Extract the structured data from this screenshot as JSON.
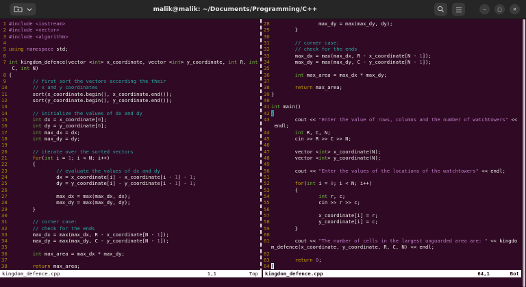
{
  "titlebar": {
    "title": "malik@malik: ~/Documents/Programming/C++",
    "minimize_glyph": "–",
    "maximize_glyph": "▢",
    "close_glyph": "✕"
  },
  "colors": {
    "terminal_bg": "#300A24",
    "header_bg": "#262626",
    "foreground": "#EFEFEC",
    "line_number": "#A98F00",
    "comment": "#2AA7A7",
    "string_preproc": "#BD7BC4",
    "keyword": "#C4A000",
    "type": "#6CB33E",
    "number": "#AD7FA8",
    "matchparen_bg": "#2BA6A6",
    "statusbar_bg": "#FFFFFF"
  },
  "icons": [
    "new-tab-folder-icon",
    "chevron-down-icon",
    "search-icon",
    "menu-icon",
    "minimize-icon",
    "maximize-icon",
    "close-icon"
  ],
  "panes": [
    {
      "side": "left",
      "status": {
        "file": "kingdom_defence.cpp",
        "ruler": "1,1",
        "pos": "Top"
      },
      "rows": [
        {
          "n": "1",
          "t": [
            [
              "s",
              "#include"
            ],
            [
              "w",
              " "
            ],
            [
              "s",
              "<iostream>"
            ]
          ]
        },
        {
          "n": "2",
          "t": [
            [
              "s",
              "#include"
            ],
            [
              "w",
              " "
            ],
            [
              "s",
              "<vector>"
            ]
          ]
        },
        {
          "n": "3",
          "t": [
            [
              "s",
              "#include"
            ],
            [
              "w",
              " "
            ],
            [
              "s",
              "<algorithm>"
            ]
          ]
        },
        {
          "n": "4",
          "t": []
        },
        {
          "n": "5",
          "t": [
            [
              "k",
              "using"
            ],
            [
              "w",
              " "
            ],
            [
              "s",
              "namespace"
            ],
            [
              "w",
              " std;"
            ]
          ]
        },
        {
          "n": "6",
          "t": []
        },
        {
          "n": "7",
          "t": [
            [
              "t",
              "int"
            ],
            [
              "w",
              " kingdom_defence(vector <"
            ],
            [
              "t",
              "int"
            ],
            [
              "w",
              "> x_coordinate, vector <"
            ],
            [
              "t",
              "int"
            ],
            [
              "w",
              "> y_coordinate, "
            ],
            [
              "t",
              "int"
            ],
            [
              "w",
              " R, "
            ],
            [
              "t",
              "int"
            ]
          ]
        },
        {
          "n": "",
          "t": [
            [
              "w",
              " C, "
            ],
            [
              "t",
              "int"
            ],
            [
              "w",
              " N)"
            ]
          ]
        },
        {
          "n": "8",
          "t": [
            [
              "w",
              "{"
            ]
          ]
        },
        {
          "n": "9",
          "t": [
            [
              "c",
              "        // first sort the vectors according the their"
            ]
          ]
        },
        {
          "n": "10",
          "t": [
            [
              "c",
              "        // x and y coordinates"
            ]
          ]
        },
        {
          "n": "11",
          "t": [
            [
              "w",
              "        sort(x_coordinate.begin(), x_coordinate.end());"
            ]
          ]
        },
        {
          "n": "12",
          "t": [
            [
              "w",
              "        sort(y_coordinate.begin(), y_coordinate.end());"
            ]
          ]
        },
        {
          "n": "13",
          "t": []
        },
        {
          "n": "14",
          "t": [
            [
              "c",
              "        // initialize the values of dx and dy"
            ]
          ]
        },
        {
          "n": "15",
          "t": [
            [
              "w",
              "        "
            ],
            [
              "t",
              "int"
            ],
            [
              "w",
              " dx = x_coordinate["
            ],
            [
              "m",
              "0"
            ],
            [
              "w",
              "];"
            ]
          ]
        },
        {
          "n": "16",
          "t": [
            [
              "w",
              "        "
            ],
            [
              "t",
              "int"
            ],
            [
              "w",
              " dy = y_coordinate["
            ],
            [
              "m",
              "0"
            ],
            [
              "w",
              "];"
            ]
          ]
        },
        {
          "n": "17",
          "t": [
            [
              "w",
              "        "
            ],
            [
              "t",
              "int"
            ],
            [
              "w",
              " max_dx = dx;"
            ]
          ]
        },
        {
          "n": "18",
          "t": [
            [
              "w",
              "        "
            ],
            [
              "t",
              "int"
            ],
            [
              "w",
              " max_dy = dy;"
            ]
          ]
        },
        {
          "n": "19",
          "t": []
        },
        {
          "n": "20",
          "t": [
            [
              "c",
              "        // iterate over the sorted vectors"
            ]
          ]
        },
        {
          "n": "21",
          "t": [
            [
              "w",
              "        "
            ],
            [
              "k",
              "for"
            ],
            [
              "w",
              "("
            ],
            [
              "t",
              "int"
            ],
            [
              "w",
              " i = "
            ],
            [
              "m",
              "1"
            ],
            [
              "w",
              "; i < N; i++)"
            ]
          ]
        },
        {
          "n": "22",
          "t": [
            [
              "w",
              "        {"
            ]
          ]
        },
        {
          "n": "23",
          "t": [
            [
              "c",
              "                // evaluate the values of dx and dy"
            ]
          ]
        },
        {
          "n": "24",
          "t": [
            [
              "w",
              "                dx = x_coordinate[i] - x_coordinate[i - "
            ],
            [
              "m",
              "1"
            ],
            [
              "w",
              "] - "
            ],
            [
              "m",
              "1"
            ],
            [
              "w",
              ";"
            ]
          ]
        },
        {
          "n": "25",
          "t": [
            [
              "w",
              "                dy = y_coordinate[i] - y_coordinate[i - "
            ],
            [
              "m",
              "1"
            ],
            [
              "w",
              "] - "
            ],
            [
              "m",
              "1"
            ],
            [
              "w",
              ";"
            ]
          ]
        },
        {
          "n": "26",
          "t": []
        },
        {
          "n": "27",
          "t": [
            [
              "w",
              "                max_dx = max(max_dx, dx);"
            ]
          ]
        },
        {
          "n": "28",
          "t": [
            [
              "w",
              "                max_dy = max(max_dy, dy);"
            ]
          ]
        },
        {
          "n": "29",
          "t": [
            [
              "w",
              "        }"
            ]
          ]
        },
        {
          "n": "30",
          "t": []
        },
        {
          "n": "31",
          "t": [
            [
              "c",
              "        // corner case:"
            ]
          ]
        },
        {
          "n": "32",
          "t": [
            [
              "c",
              "        // check for the ends"
            ]
          ]
        },
        {
          "n": "33",
          "t": [
            [
              "w",
              "        max_dx = max(max_dx, R - x_coordinate[N - "
            ],
            [
              "m",
              "1"
            ],
            [
              "w",
              "]);"
            ]
          ]
        },
        {
          "n": "34",
          "t": [
            [
              "w",
              "        max_dy = max(max_dy, C - y_coordinate[N - "
            ],
            [
              "m",
              "1"
            ],
            [
              "w",
              "]);"
            ]
          ]
        },
        {
          "n": "35",
          "t": []
        },
        {
          "n": "36",
          "t": [
            [
              "w",
              "        "
            ],
            [
              "t",
              "int"
            ],
            [
              "w",
              " max_area = max_dx * max_dy;"
            ]
          ]
        },
        {
          "n": "37",
          "t": []
        },
        {
          "n": "38",
          "t": [
            [
              "w",
              "        "
            ],
            [
              "k",
              "return"
            ],
            [
              "w",
              " max_area;"
            ]
          ]
        }
      ]
    },
    {
      "side": "right",
      "status": {
        "file": "kingdom_defence.cpp",
        "ruler": "64,1",
        "pos": "Bot"
      },
      "rows": [
        {
          "n": "28",
          "t": [
            [
              "w",
              "                max_dy = max(max_dy, dy);"
            ]
          ]
        },
        {
          "n": "29",
          "t": [
            [
              "w",
              "        }"
            ]
          ]
        },
        {
          "n": "30",
          "t": []
        },
        {
          "n": "31",
          "t": [
            [
              "c",
              "        // corner case:"
            ]
          ]
        },
        {
          "n": "32",
          "t": [
            [
              "c",
              "        // check for the ends"
            ]
          ]
        },
        {
          "n": "33",
          "t": [
            [
              "w",
              "        max_dx = max(max_dx, R - x_coordinate[N - "
            ],
            [
              "m",
              "1"
            ],
            [
              "w",
              "]);"
            ]
          ]
        },
        {
          "n": "34",
          "t": [
            [
              "w",
              "        max_dy = max(max_dy, C - y_coordinate[N - "
            ],
            [
              "m",
              "1"
            ],
            [
              "w",
              "]);"
            ]
          ]
        },
        {
          "n": "35",
          "t": []
        },
        {
          "n": "36",
          "t": [
            [
              "w",
              "        "
            ],
            [
              "t",
              "int"
            ],
            [
              "w",
              " max_area = max_dx * max_dy;"
            ]
          ]
        },
        {
          "n": "37",
          "t": []
        },
        {
          "n": "38",
          "t": [
            [
              "w",
              "        "
            ],
            [
              "k",
              "return"
            ],
            [
              "w",
              " max_area;"
            ]
          ]
        },
        {
          "n": "39",
          "t": [
            [
              "w",
              "}"
            ]
          ]
        },
        {
          "n": "40",
          "t": []
        },
        {
          "n": "41",
          "t": [
            [
              "t",
              "int"
            ],
            [
              "w",
              " main()"
            ]
          ]
        },
        {
          "n": "42",
          "t": [
            [
              "mp",
              "{"
            ]
          ]
        },
        {
          "n": "43",
          "t": [
            [
              "w",
              "        cout << "
            ],
            [
              "s",
              "\"Enter the value of rows, columns and the number of watchtowers\""
            ],
            [
              "w",
              " <<"
            ]
          ]
        },
        {
          "n": "",
          "t": [
            [
              "w",
              " endl;"
            ]
          ]
        },
        {
          "n": "44",
          "t": [
            [
              "w",
              "        "
            ],
            [
              "t",
              "int"
            ],
            [
              "w",
              " R, C, N;"
            ]
          ]
        },
        {
          "n": "45",
          "t": [
            [
              "w",
              "        cin >> R >> C >> N;"
            ]
          ]
        },
        {
          "n": "46",
          "t": []
        },
        {
          "n": "47",
          "t": [
            [
              "w",
              "        vector <"
            ],
            [
              "t",
              "int"
            ],
            [
              "w",
              "> x_coordinate(N);"
            ]
          ]
        },
        {
          "n": "48",
          "t": [
            [
              "w",
              "        vector <"
            ],
            [
              "t",
              "int"
            ],
            [
              "w",
              "> y_coordinate(N);"
            ]
          ]
        },
        {
          "n": "49",
          "t": []
        },
        {
          "n": "50",
          "t": [
            [
              "w",
              "        cout << "
            ],
            [
              "s",
              "\"Enter the values of the locations of the watchtowers\""
            ],
            [
              "w",
              " << endl;"
            ]
          ]
        },
        {
          "n": "51",
          "t": []
        },
        {
          "n": "52",
          "t": [
            [
              "w",
              "        "
            ],
            [
              "k",
              "for"
            ],
            [
              "w",
              "("
            ],
            [
              "t",
              "int"
            ],
            [
              "w",
              " i = "
            ],
            [
              "m",
              "0"
            ],
            [
              "w",
              "; i < N; i++)"
            ]
          ]
        },
        {
          "n": "53",
          "t": [
            [
              "w",
              "        {"
            ]
          ]
        },
        {
          "n": "54",
          "t": [
            [
              "w",
              "                "
            ],
            [
              "t",
              "int"
            ],
            [
              "w",
              " r, c;"
            ]
          ]
        },
        {
          "n": "55",
          "t": [
            [
              "w",
              "                cin >> r >> c;"
            ]
          ]
        },
        {
          "n": "56",
          "t": []
        },
        {
          "n": "57",
          "t": [
            [
              "w",
              "                x_coordinate[i] = r;"
            ]
          ]
        },
        {
          "n": "58",
          "t": [
            [
              "w",
              "                y_coordinate[i] = c;"
            ]
          ]
        },
        {
          "n": "59",
          "t": [
            [
              "w",
              "        }"
            ]
          ]
        },
        {
          "n": "60",
          "t": []
        },
        {
          "n": "61",
          "t": [
            [
              "w",
              "        cout << "
            ],
            [
              "s",
              "\"The number of cells in the largest unguarded area are: \""
            ],
            [
              "w",
              " << kingdo"
            ]
          ]
        },
        {
          "n": "",
          "t": [
            [
              "w",
              "m_defence(x_coordinate, y_coordinate, R, C, N) << endl;"
            ]
          ]
        },
        {
          "n": "62",
          "t": []
        },
        {
          "n": "63",
          "t": [
            [
              "w",
              "        "
            ],
            [
              "k",
              "return"
            ],
            [
              "w",
              " "
            ],
            [
              "m",
              "0"
            ],
            [
              "w",
              ";"
            ]
          ]
        },
        {
          "n": "64",
          "t": [
            [
              "cur",
              "}"
            ]
          ]
        }
      ]
    }
  ]
}
